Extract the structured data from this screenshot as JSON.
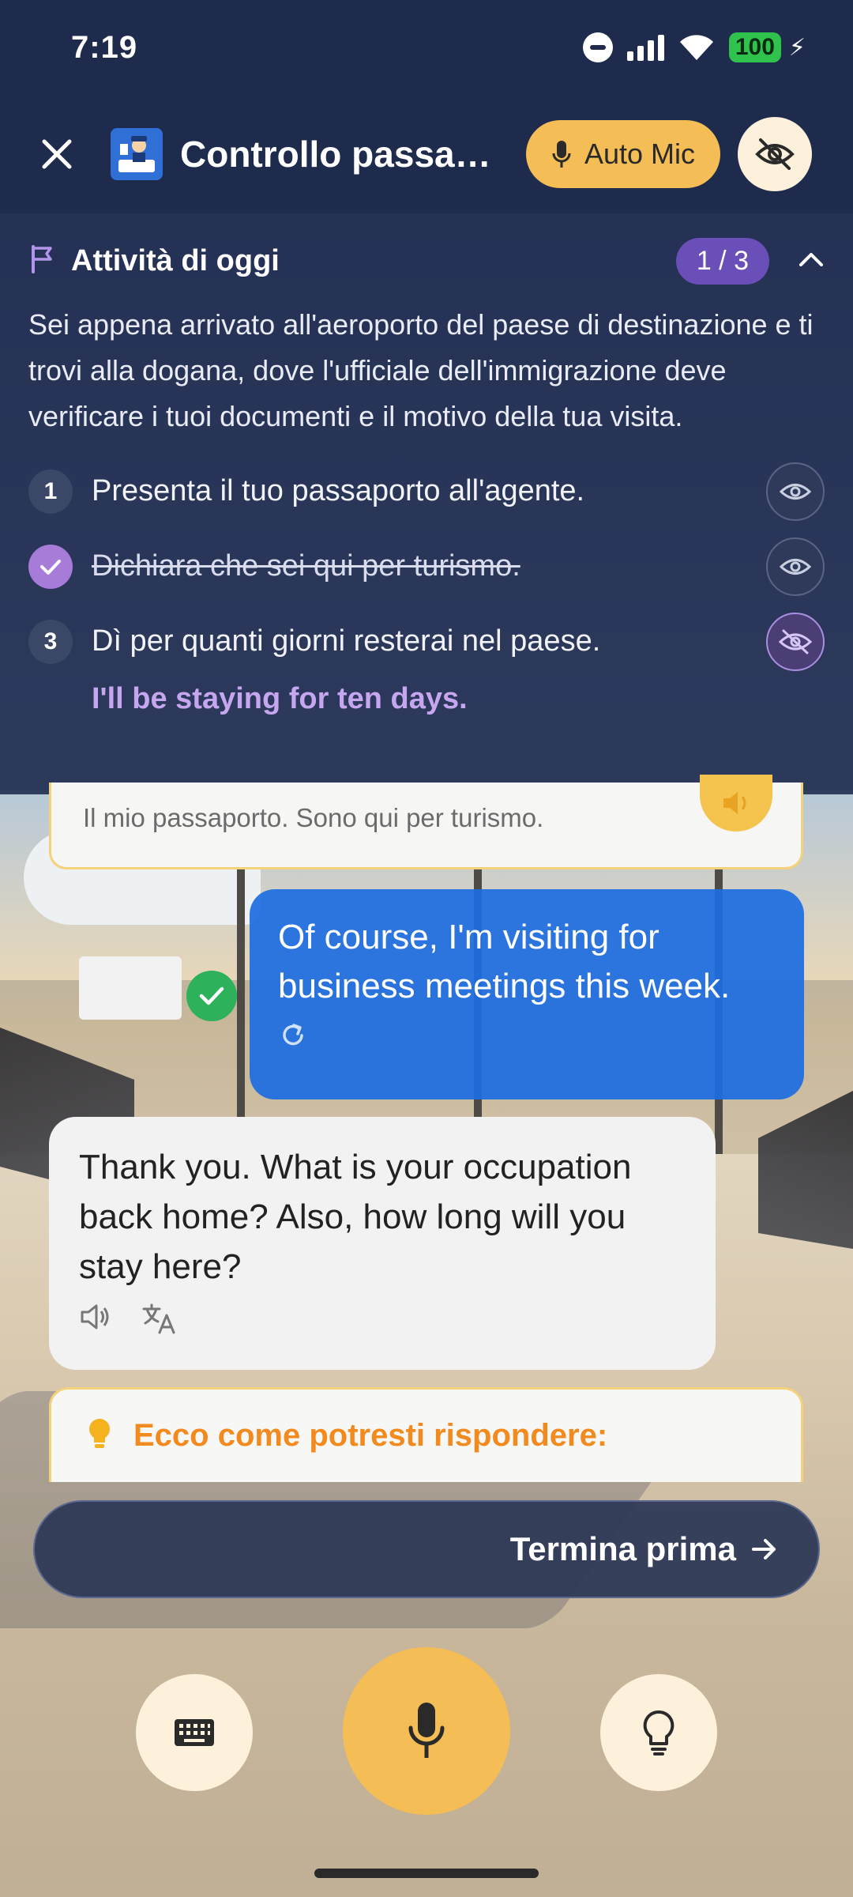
{
  "status_bar": {
    "time": "7:19",
    "battery": "100"
  },
  "header": {
    "title": "Controllo passaporti",
    "auto_mic_label": "Auto Mic"
  },
  "task_panel": {
    "label": "Attività di oggi",
    "counter": "1 / 3",
    "description": "Sei appena arrivato all'aeroporto del paese di destinazione e ti trovi alla dogana, dove l'ufficiale dell'immigrazione deve verificare i tuoi documenti e il motivo della tua visita.",
    "steps": [
      {
        "number": "1",
        "text": "Presenta il tuo passaporto all'agente.",
        "completed": false
      },
      {
        "number": "2",
        "text": "Dichiara che sei qui per turismo.",
        "completed": true
      },
      {
        "number": "3",
        "text": "Dì per quanti giorni resterai nel paese.",
        "completed": false
      }
    ],
    "hint_answer": "I'll be staying for ten days."
  },
  "chat": {
    "partial_translation": "Il mio passaporto. Sono qui per turismo.",
    "user_message": "Of course, I'm visiting for business meetings this week.",
    "bot_message": "Thank you. What is your occupation back home? Also, how long will you stay here?",
    "suggestion_label": "Ecco come potresti rispondere:"
  },
  "end_button": {
    "label": "Termina prima"
  },
  "colors": {
    "accent_yellow": "#f4bd55",
    "user_bubble": "#1e6ee1",
    "step_done": "#a77cd8",
    "suggestion_orange": "#f28a1e"
  },
  "icons": {
    "close": "close-icon",
    "title": "passport-officer-icon",
    "mic": "mic-icon",
    "hide": "eye-off-icon",
    "flag": "flag-icon",
    "chevron": "chevron-up-icon",
    "eye": "eye-icon",
    "check": "check-icon",
    "retry": "refresh-icon",
    "speaker": "speaker-icon",
    "translate": "translate-icon",
    "bulb": "lightbulb-icon",
    "arrow": "arrow-right-icon",
    "keyboard": "keyboard-icon"
  }
}
